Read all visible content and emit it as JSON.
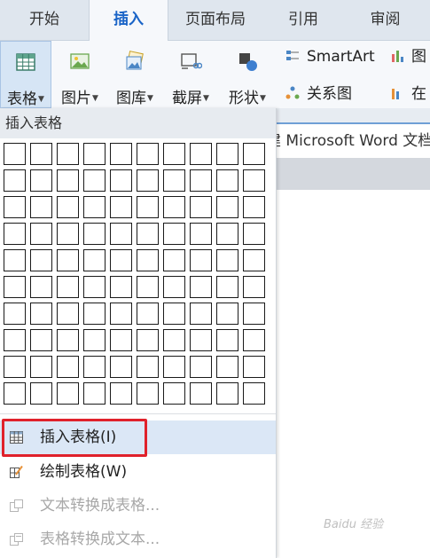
{
  "tabs": [
    "开始",
    "插入",
    "页面布局",
    "引用",
    "审阅"
  ],
  "ribbon": {
    "table": "表格",
    "picture": "图片",
    "gallery": "图库",
    "screenshot": "截屏",
    "shapes": "形状",
    "smartart": "SmartArt",
    "relation": "关系图",
    "chart_partial": "图",
    "online_partial": "在"
  },
  "document_tab": "建 Microsoft Word 文档",
  "dropdown": {
    "header": "插入表格",
    "grid": {
      "rows": 10,
      "cols": 10
    },
    "items": [
      {
        "label": "插入表格(I)",
        "state": "hover",
        "icon": "table-icon"
      },
      {
        "label": "绘制表格(W)",
        "state": "normal",
        "icon": "draw-table-icon"
      },
      {
        "label": "文本转换成表格...",
        "state": "disabled",
        "icon": "text-to-table-icon"
      },
      {
        "label": "表格转换成文本...",
        "state": "disabled",
        "icon": "table-to-text-icon"
      }
    ]
  },
  "watermark": "Baidu 经验",
  "colors": {
    "accent": "#1a64c7",
    "highlight": "#e0212b",
    "hover": "#dbe7f6"
  }
}
